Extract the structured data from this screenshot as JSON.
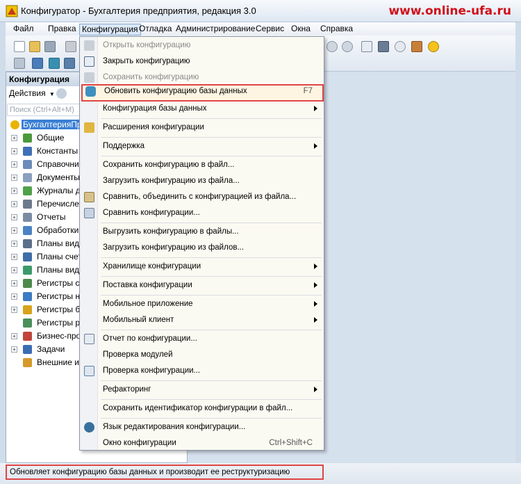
{
  "window": {
    "title": "Конфигуратор - Бухгалтерия предприятия, редакция 3.0",
    "watermark": "www.online-ufa.ru"
  },
  "menubar": {
    "items": [
      {
        "label": "Файл"
      },
      {
        "label": "Правка"
      },
      {
        "label": "Конфигурация"
      },
      {
        "label": "Отладка"
      },
      {
        "label": "Администрирование"
      },
      {
        "label": "Сервис"
      },
      {
        "label": "Окна"
      },
      {
        "label": "Справка"
      }
    ]
  },
  "left_panel": {
    "header": "Конфигурация",
    "actions_label": "Действия",
    "search_placeholder": "Поиск (Ctrl+Alt+M)",
    "tree": [
      {
        "label": "БухгалтерияПре",
        "icon": "config-root-icon",
        "color": "#e8b400"
      },
      {
        "label": "Общие",
        "icon": "common-icon",
        "color": "#4a9a3c"
      },
      {
        "label": "Константы",
        "icon": "constants-icon",
        "color": "#3f6fb5"
      },
      {
        "label": "Справочники",
        "icon": "catalogs-icon",
        "color": "#6b8bb8"
      },
      {
        "label": "Документы",
        "icon": "documents-icon",
        "color": "#8aa0be"
      },
      {
        "label": "Журналы до",
        "icon": "journals-icon",
        "color": "#4fa14a"
      },
      {
        "label": "Перечислен",
        "icon": "enums-icon",
        "color": "#6c7a8c"
      },
      {
        "label": "Отчеты",
        "icon": "reports-icon",
        "color": "#7a8ca2"
      },
      {
        "label": "Обработки",
        "icon": "dataprocessors-icon",
        "color": "#4b82c4"
      },
      {
        "label": "Планы видо",
        "icon": "chart-types-icon",
        "color": "#5b6f8a"
      },
      {
        "label": "Планы счето",
        "icon": "chart-accounts-icon",
        "color": "#3d6ea8"
      },
      {
        "label": "Планы видо",
        "icon": "calc-types-icon",
        "color": "#3c9a6a"
      },
      {
        "label": "Регистры св",
        "icon": "info-registers-icon",
        "color": "#4d8a4b"
      },
      {
        "label": "Регистры на",
        "icon": "accum-registers-icon",
        "color": "#3b7cc2"
      },
      {
        "label": "Регистры бу",
        "icon": "acc-registers-icon",
        "color": "#d7a21c"
      },
      {
        "label": "Регистры ра",
        "icon": "calc-registers-icon",
        "color": "#4a8f5a"
      },
      {
        "label": "Бизнес-проц",
        "icon": "business-processes-icon",
        "color": "#c0453a"
      },
      {
        "label": "Задачи",
        "icon": "tasks-icon",
        "color": "#3b6db3"
      },
      {
        "label": "Внешние ис",
        "icon": "external-sources-icon",
        "color": "#d49a2a"
      }
    ]
  },
  "dropdown": {
    "items": [
      {
        "label": "Открыть конфигурацию",
        "disabled": true,
        "icon": "open-config-icon"
      },
      {
        "label": "Закрыть конфигурацию",
        "disabled": false,
        "icon": "close-config-icon"
      },
      {
        "label": "Сохранить конфигурацию",
        "disabled": true,
        "icon": "save-config-icon"
      },
      {
        "label": "Обновить конфигурацию базы данных",
        "shortcut": "F7",
        "highlight": true,
        "icon": "update-db-config-icon"
      },
      {
        "label": "Конфигурация базы данных",
        "submenu": true
      },
      {
        "label": "Расширения конфигурации",
        "icon": "extensions-icon"
      },
      {
        "label": "Поддержка",
        "submenu": true
      },
      {
        "label": "Сохранить конфигурацию в файл..."
      },
      {
        "label": "Загрузить конфигурацию из файла..."
      },
      {
        "label": "Сравнить, объединить с конфигурацией из файла...",
        "icon": "compare-merge-icon"
      },
      {
        "label": "Сравнить конфигурации...",
        "icon": "compare-configs-icon"
      },
      {
        "label": "Выгрузить конфигурацию в файлы..."
      },
      {
        "label": "Загрузить конфигурацию из файлов..."
      },
      {
        "label": "Хранилище конфигурации",
        "submenu": true
      },
      {
        "label": "Поставка конфигурации",
        "submenu": true
      },
      {
        "label": "Мобильное приложение",
        "submenu": true
      },
      {
        "label": "Мобильный клиент",
        "submenu": true
      },
      {
        "label": "Отчет по конфигурации...",
        "icon": "config-report-icon"
      },
      {
        "label": "Проверка модулей"
      },
      {
        "label": "Проверка конфигурации...",
        "icon": "check-config-icon"
      },
      {
        "label": "Рефакторинг",
        "submenu": true
      },
      {
        "label": "Сохранить идентификатор конфигурации в файл..."
      },
      {
        "label": "Язык редактирования конфигурации...",
        "icon": "edit-language-icon"
      },
      {
        "label": "Окно конфигурации",
        "shortcut": "Ctrl+Shift+C"
      }
    ]
  },
  "statusbar": {
    "text": "Обновляет конфигурацию базы данных и производит ее реструктуризацию"
  },
  "colors": {
    "highlight_border": "#e04444",
    "watermark": "#d0101a",
    "selection": "#3a7fd4"
  }
}
